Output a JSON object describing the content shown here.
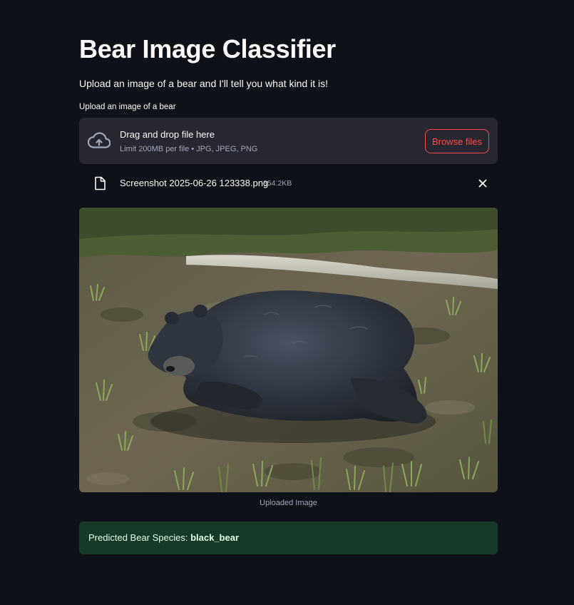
{
  "header": {
    "title": "Bear Image Classifier",
    "subtitle": "Upload an image of a bear and I'll tell you what kind it is!"
  },
  "uploader": {
    "label": "Upload an image of a bear",
    "drop_title": "Drag and drop file here",
    "limit_text": "Limit 200MB per file • JPG, JPEG, PNG",
    "browse_label": "Browse files",
    "icon": "cloud-upload-icon"
  },
  "file": {
    "name": "Screenshot 2025-06-26 123338.png",
    "size": "354.2KB",
    "icon": "file-icon",
    "remove_icon": "close-icon"
  },
  "image": {
    "caption": "Uploaded Image"
  },
  "result": {
    "prefix": "Predicted Bear Species: ",
    "species": "black_bear"
  },
  "colors": {
    "background": "#0e1117",
    "panel": "#262730",
    "accent": "#ff4b4b",
    "success_bg": "#173928",
    "success_text": "#dffde9"
  }
}
